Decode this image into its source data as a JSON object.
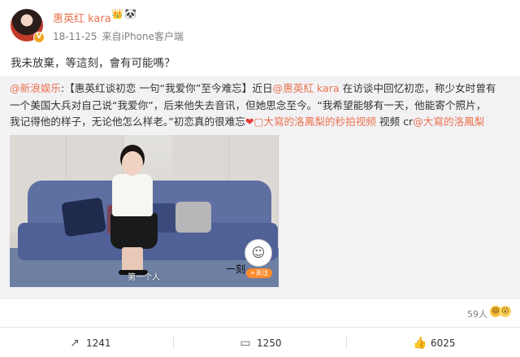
{
  "header": {
    "username": "惠英红 kara",
    "badges": [
      "👑",
      "🐼"
    ],
    "date": "18-11-25",
    "source": "来自iPhone客户端",
    "verified_mark": "V"
  },
  "post": {
    "text": "我未放棄，等這刻，會有可能嗎？"
  },
  "repost": {
    "line1_link1": "@新浪娱乐",
    "line1_a": ":【惠英红谈初恋 一句“我爱你”至今难忘】近日",
    "line1_link2": "@惠英紅 kara",
    "line1_b": " 在访谈中回忆初恋，称少女时曾有",
    "line2": "一个美国大兵对自己说“我爱你”，后来他失去音讯，但她思念至今。“我希望能够有一天，他能寄个照片，",
    "line3_a": "我记得他的样子，无论他怎么样老。”初恋真的很难忘",
    "heart": "❤",
    "line3_link1": "▢大寫的洛鳳梨的秒拍视频",
    "line3_b": " 视频 cr",
    "line3_link2": "@大寫的洛鳳梨",
    "video": {
      "caption": "第一个人",
      "watermark": "一刻",
      "follow": "+关注"
    }
  },
  "likers": {
    "count": "59人",
    "emojis": [
      "😄",
      "😮"
    ]
  },
  "actions": {
    "repost_count": "1241",
    "comment_count": "1250",
    "like_count": "6025"
  },
  "colors": {
    "accent": "#eb7350",
    "repost_bg": "#f2f2f5",
    "meta_text": "#808080"
  }
}
